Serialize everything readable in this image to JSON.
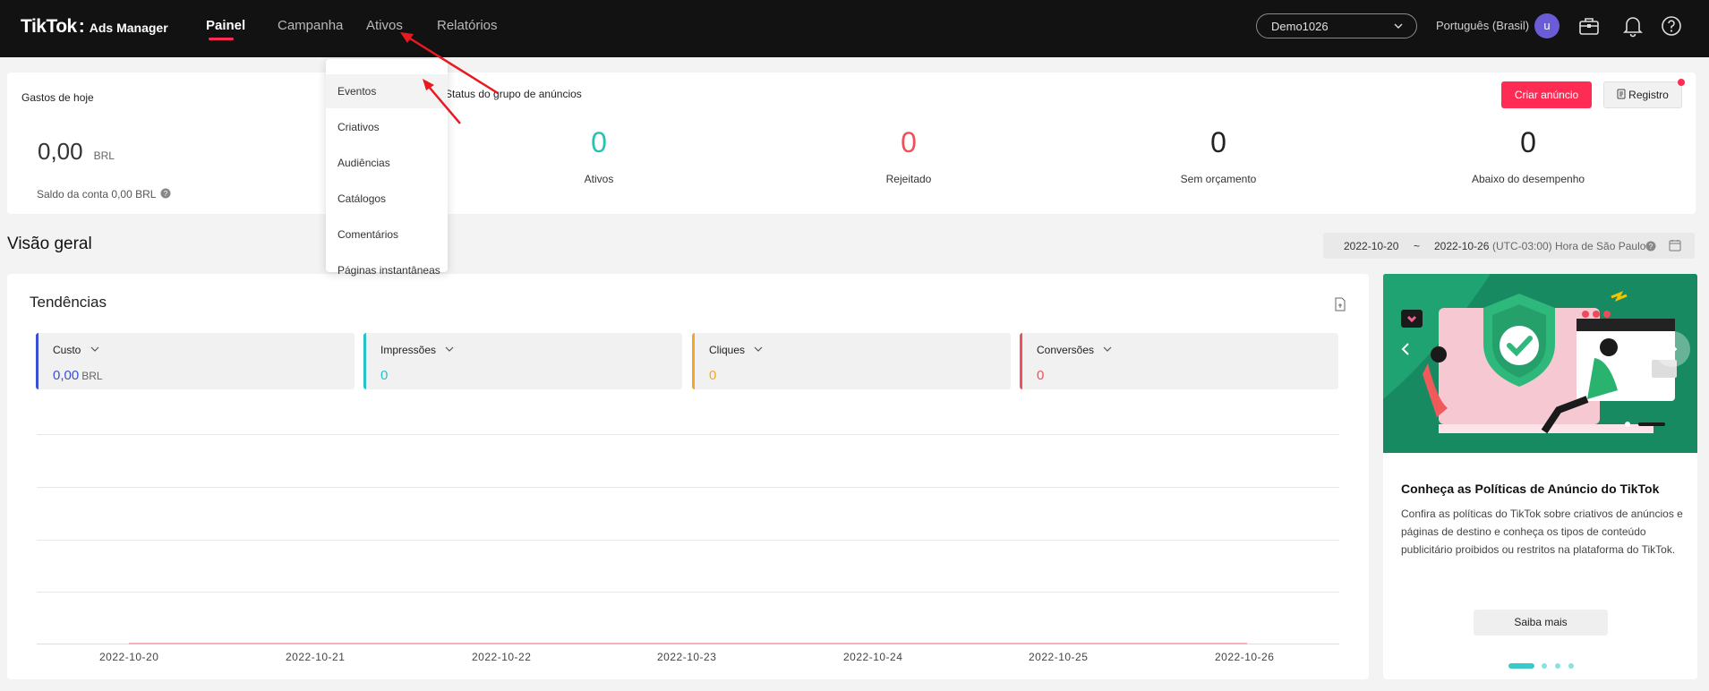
{
  "header": {
    "logo_main": "TikTok",
    "logo_sub": "Ads Manager",
    "nav": [
      "Painel",
      "Campanha",
      "Ativos",
      "Relatórios"
    ],
    "account": "Demo1026",
    "language": "Português (Brasil)",
    "avatar_letter": "u"
  },
  "assets_menu": [
    "Eventos",
    "Criativos",
    "Audiências",
    "Catálogos",
    "Comentários",
    "Páginas instantâneas"
  ],
  "summary": {
    "spend_title": "Gastos de hoje",
    "spend_value": "0,00",
    "spend_currency": "BRL",
    "balance": "Saldo da conta 0,00 BRL",
    "adgroup_status_title": "Status do grupo de anúncios",
    "stats": [
      {
        "value": "0",
        "label": "Ativos",
        "color": "#25c2b5"
      },
      {
        "value": "0",
        "label": "Rejeitado",
        "color": "#f0505a"
      },
      {
        "value": "0",
        "label": "Sem orçamento",
        "color": "#222222"
      },
      {
        "value": "0",
        "label": "Abaixo do desempenho",
        "color": "#222222"
      }
    ],
    "create_ad": "Criar anúncio",
    "record": "Registro"
  },
  "overview": {
    "title": "Visão geral",
    "date_start": "2022-10-20",
    "date_sep": "~",
    "date_end": "2022-10-26",
    "timezone": "(UTC-03:00) Hora de São Paulo"
  },
  "trends": {
    "title": "Tendências",
    "metrics": [
      {
        "label": "Custo",
        "value": "0,00",
        "unit": "BRL",
        "color": "#3a4fd8"
      },
      {
        "label": "Impressões",
        "value": "0",
        "unit": "",
        "color": "#25c2c9"
      },
      {
        "label": "Cliques",
        "value": "0",
        "unit": "",
        "color": "#f5a623"
      },
      {
        "label": "Conversões",
        "value": "0",
        "unit": "",
        "color": "#f0505a"
      }
    ],
    "x_ticks": [
      "2022-10-20",
      "2022-10-21",
      "2022-10-22",
      "2022-10-23",
      "2022-10-24",
      "2022-10-25",
      "2022-10-26"
    ]
  },
  "promo": {
    "title": "Conheça as Políticas de Anúncio do TikTok",
    "body": "Confira as políticas do TikTok sobre criativos de anúncios e páginas de destino e conheça os tipos de conteúdo publicitário proibidos ou restritos na plataforma do TikTok.",
    "button": "Saiba mais"
  }
}
